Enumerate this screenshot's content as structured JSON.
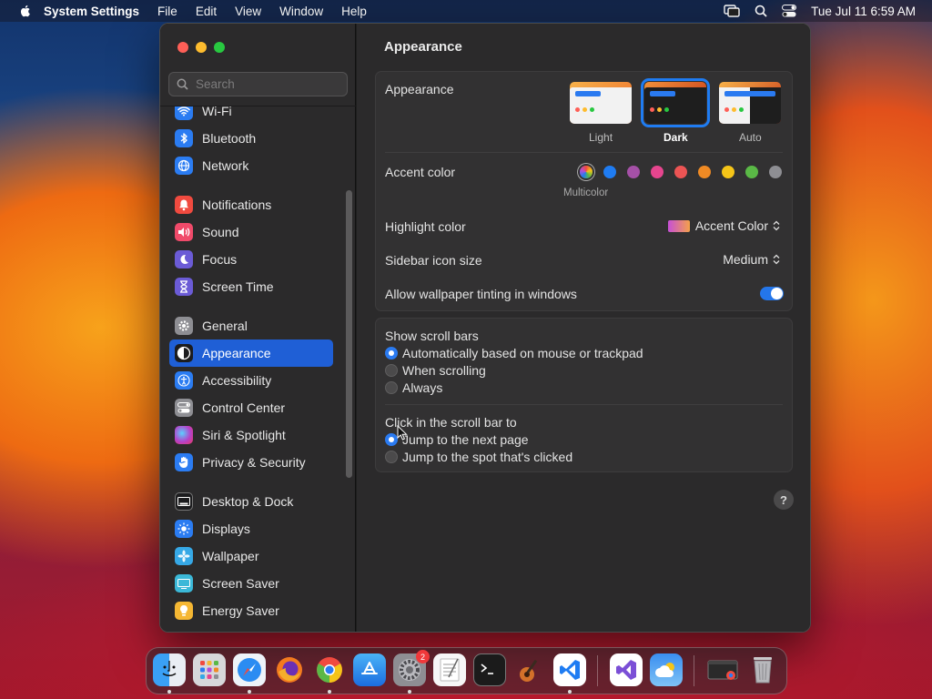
{
  "menubar": {
    "app_name": "System Settings",
    "items": [
      "File",
      "Edit",
      "View",
      "Window",
      "Help"
    ],
    "clock": "Tue Jul 11  6:59 AM"
  },
  "sidebar": {
    "search_placeholder": "Search",
    "items": [
      {
        "label": "Wi-Fi",
        "icon": "wifi-icon",
        "color": "#2b7cf2"
      },
      {
        "label": "Bluetooth",
        "icon": "bluetooth-icon",
        "color": "#2b7cf2"
      },
      {
        "label": "Network",
        "icon": "globe-icon",
        "color": "#2b7cf2"
      },
      {
        "label": "Notifications",
        "icon": "bell-icon",
        "color": "#f04a3f"
      },
      {
        "label": "Sound",
        "icon": "speaker-icon",
        "color": "#f04a6a"
      },
      {
        "label": "Focus",
        "icon": "moon-icon",
        "color": "#6b5bd6"
      },
      {
        "label": "Screen Time",
        "icon": "hourglass-icon",
        "color": "#6b5bd6"
      },
      {
        "label": "General",
        "icon": "gear-icon",
        "color": "#8e8e93"
      },
      {
        "label": "Appearance",
        "icon": "appearance-icon",
        "color": "#1c1c1e"
      },
      {
        "label": "Accessibility",
        "icon": "accessibility-icon",
        "color": "#2b7cf2"
      },
      {
        "label": "Control Center",
        "icon": "control-center-icon",
        "color": "#8e8e93"
      },
      {
        "label": "Siri & Spotlight",
        "icon": "siri-icon",
        "color": "#b541c9"
      },
      {
        "label": "Privacy & Security",
        "icon": "hand-icon",
        "color": "#2b7cf2"
      },
      {
        "label": "Desktop & Dock",
        "icon": "dock-icon",
        "color": "#1c1c1e"
      },
      {
        "label": "Displays",
        "icon": "sun-icon",
        "color": "#2b7cf2"
      },
      {
        "label": "Wallpaper",
        "icon": "wallpaper-icon",
        "color": "#36a8e6"
      },
      {
        "label": "Screen Saver",
        "icon": "screen-saver-icon",
        "color": "#3bb8d8"
      },
      {
        "label": "Energy Saver",
        "icon": "bulb-icon",
        "color": "#f5b733"
      }
    ],
    "selected": "Appearance"
  },
  "content": {
    "title": "Appearance",
    "appearance": {
      "label": "Appearance",
      "options": [
        "Light",
        "Dark",
        "Auto"
      ],
      "selected": "Dark"
    },
    "accent": {
      "label": "Accent color",
      "caption": "Multicolor",
      "colors": [
        "#b64fd6",
        "#1f7cf2",
        "#a550a7",
        "#e6458e",
        "#ec5454",
        "#f08a24",
        "#f5c518",
        "#5ab946",
        "#8e8e93"
      ]
    },
    "highlight": {
      "label": "Highlight color",
      "value": "Accent Color"
    },
    "icon_size": {
      "label": "Sidebar icon size",
      "value": "Medium"
    },
    "tinting": {
      "label": "Allow wallpaper tinting in windows",
      "enabled": true
    },
    "scroll_bars": {
      "label": "Show scroll bars",
      "options": [
        "Automatically based on mouse or trackpad",
        "When scrolling",
        "Always"
      ],
      "selected": "Automatically based on mouse or trackpad"
    },
    "click_scroll": {
      "label": "Click in the scroll bar to",
      "options": [
        "Jump to the next page",
        "Jump to the spot that's clicked"
      ],
      "selected": "Jump to the next page"
    },
    "help": "?"
  },
  "dock": {
    "apps": [
      "Finder",
      "Launchpad",
      "Safari",
      "Firefox",
      "Chrome",
      "App Store",
      "System Settings",
      "TextEdit",
      "Terminal",
      "GarageBand",
      "Visual Studio Code",
      "Visual Studio",
      "Weather",
      "Recent Window",
      "Trash"
    ],
    "settings_badge": "2"
  }
}
